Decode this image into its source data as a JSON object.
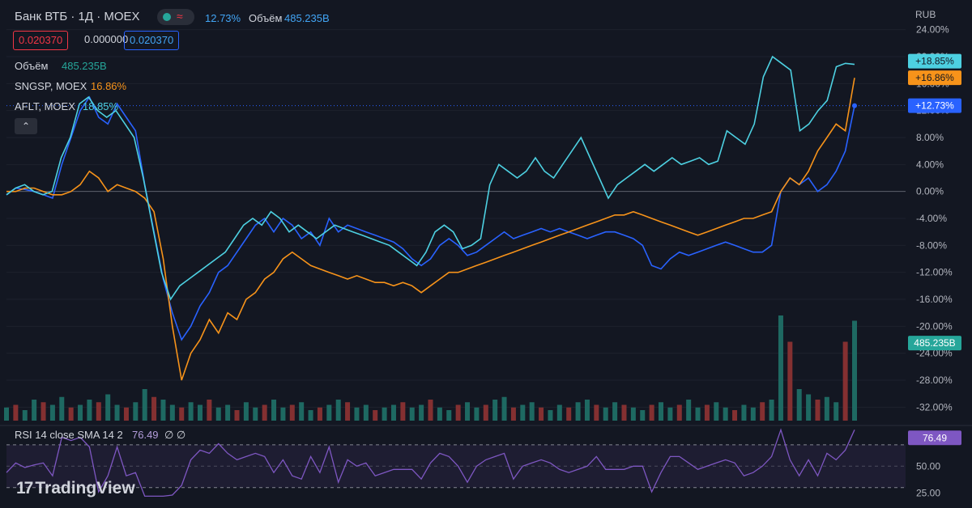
{
  "header": {
    "title": "Банк ВТБ · 1Д · MOEX",
    "change_pct": "12.73%",
    "volume_label": "Объём",
    "volume_value": "485.235B",
    "ohlc": [
      "0.020370",
      "0.000000",
      "0.020370"
    ]
  },
  "legend": [
    {
      "label": "Объём",
      "value": "485.235B",
      "color": "#26a69a"
    },
    {
      "label": "SNGSP, MOEX",
      "value": "16.86%",
      "color": "#f7931a"
    },
    {
      "label": "AFLT, MOEX",
      "value": "18.85%",
      "color": "#4dd0e1"
    }
  ],
  "collapse_icon": "chevron-up-icon",
  "currency": "RUB",
  "rsi": {
    "label": "RSI 14 close SMA 14 2",
    "value": "76.49",
    "extra": "∅ ∅",
    "levels": [
      70,
      50,
      30
    ],
    "ticks": [
      "50.00",
      "25.00"
    ]
  },
  "branding": "TradingView",
  "colors": {
    "vtb": "#2962ff",
    "sngsp": "#f7931a",
    "aflt": "#4dd0e1",
    "vol_up": "#26a69a",
    "vol_down": "#ef5350",
    "rsi": "#7e57c2"
  },
  "chart_data": {
    "type": "line",
    "title": "Банк ВТБ · 1Д · MOEX",
    "ylabel": "",
    "y_unit": "%",
    "ylim": [
      -34,
      26
    ],
    "yticks": [
      "24.00%",
      "20.00%",
      "16.00%",
      "12.00%",
      "8.00%",
      "4.00%",
      "0.00%",
      "-4.00%",
      "-8.00%",
      "-12.00%",
      "-16.00%",
      "-20.00%",
      "-24.00%",
      "-28.00%",
      "-32.00%"
    ],
    "ytick_values": [
      24,
      20,
      16,
      12,
      8,
      4,
      0,
      -4,
      -8,
      -12,
      -16,
      -20,
      -24,
      -28,
      -32
    ],
    "x": [
      0,
      2,
      4,
      6,
      8,
      10,
      12,
      14,
      16,
      18,
      20,
      22,
      24,
      26,
      28,
      30,
      32,
      34,
      36,
      38,
      40,
      42,
      44,
      46,
      48,
      50,
      52,
      54,
      56,
      58,
      60,
      62,
      64,
      66,
      68,
      70,
      72,
      74,
      76,
      78,
      80,
      82,
      84,
      86,
      88,
      90,
      92,
      94,
      96,
      98,
      100,
      102,
      104,
      106,
      108,
      110,
      112,
      114,
      116,
      118,
      120,
      122,
      124,
      126,
      128,
      130,
      132,
      134,
      136,
      138,
      140,
      142,
      144,
      146,
      148,
      150,
      152,
      154,
      156,
      158,
      160,
      162,
      164,
      166,
      168,
      170,
      172,
      174,
      176,
      178,
      180,
      182,
      184,
      186,
      188,
      190,
      192,
      194,
      196,
      198,
      200,
      202,
      204,
      206,
      208,
      210,
      212,
      214,
      216,
      218,
      220,
      222,
      224,
      226,
      228,
      230,
      232,
      234,
      236,
      238
    ],
    "series": [
      {
        "name": "Банк ВТБ",
        "color": "#2962ff",
        "values": [
          -0.5,
          0.5,
          0.3,
          0,
          -0.5,
          -1,
          4,
          8,
          12,
          14,
          11,
          10,
          13,
          11,
          9,
          1,
          -6,
          -13,
          -18,
          -22,
          -20,
          -17,
          -15,
          -12,
          -11,
          -9,
          -7,
          -5,
          -4,
          -6,
          -4,
          -5,
          -7,
          -6,
          -8,
          -4,
          -6,
          -5,
          -5.5,
          -6,
          -6.5,
          -7,
          -7.5,
          -8.5,
          -10,
          -11,
          -10,
          -8,
          -7,
          -8,
          -9.5,
          -9,
          -8,
          -7,
          -6,
          -7,
          -6.5,
          -6,
          -5.5,
          -6,
          -5.5,
          -6,
          -6.5,
          -7,
          -6.5,
          -6,
          -6,
          -6.5,
          -7,
          -8,
          -11,
          -11.5,
          -10,
          -9,
          -9.5,
          -9,
          -8.5,
          -8,
          -7.5,
          -8,
          -8.5,
          -9,
          -9,
          -8,
          0,
          2,
          1,
          2,
          0,
          1,
          3,
          6,
          12.73
        ]
      },
      {
        "name": "SNGSP, MOEX",
        "color": "#f7931a",
        "values": [
          0,
          0,
          0.5,
          0.5,
          0,
          -0.5,
          -0.5,
          0,
          1,
          3,
          2,
          0,
          1,
          0.5,
          0,
          -1,
          -3,
          -10,
          -20,
          -28,
          -24,
          -22,
          -19,
          -21,
          -18,
          -19,
          -16,
          -15,
          -13,
          -12,
          -10,
          -9,
          -10,
          -11,
          -11.5,
          -12,
          -12.5,
          -13,
          -12.5,
          -13,
          -13.5,
          -13.5,
          -14,
          -13.5,
          -14,
          -15,
          -14,
          -13,
          -12,
          -12,
          -11.5,
          -11,
          -10.5,
          -10,
          -9.5,
          -9,
          -8.5,
          -8,
          -7.5,
          -7,
          -6.5,
          -6,
          -5.5,
          -5,
          -4.5,
          -4,
          -3.5,
          -3.5,
          -3,
          -3.5,
          -4,
          -4.5,
          -5,
          -5.5,
          -6,
          -6.5,
          -6,
          -5.5,
          -5,
          -4.5,
          -4,
          -4,
          -3.5,
          -3,
          0,
          2,
          1,
          3,
          6,
          8,
          10,
          9,
          16.86
        ]
      },
      {
        "name": "AFLT, MOEX",
        "color": "#4dd0e1",
        "values": [
          -0.5,
          0.5,
          1,
          0,
          -0.5,
          0,
          5,
          8,
          13,
          14,
          12,
          11,
          12,
          10,
          8,
          2,
          -5,
          -12,
          -16,
          -14,
          -13,
          -12,
          -11,
          -10,
          -9,
          -7,
          -5,
          -4,
          -5,
          -3,
          -4,
          -6,
          -5,
          -6,
          -7,
          -6,
          -5,
          -5.5,
          -6,
          -6.5,
          -7,
          -7.5,
          -8,
          -9,
          -10,
          -11,
          -9,
          -6,
          -5,
          -6,
          -8.5,
          -8,
          -7,
          1,
          4,
          3,
          2,
          3,
          5,
          3,
          2,
          4,
          6,
          8,
          5,
          2,
          -1,
          1,
          2,
          3,
          4,
          3,
          4,
          5,
          4,
          4.5,
          5,
          4,
          4.5,
          9,
          8,
          7,
          10,
          17,
          20,
          19,
          18,
          9,
          10,
          12,
          13.5,
          18.5,
          19,
          18.85
        ]
      }
    ],
    "end_labels": [
      "+18.85%",
      "+16.86%",
      "+12.73%",
      "485.235B"
    ],
    "volume": {
      "values": [
        5,
        6,
        4,
        8,
        7,
        6,
        9,
        5,
        6,
        8,
        7,
        10,
        6,
        5,
        7,
        12,
        9,
        8,
        6,
        5,
        7,
        6,
        8,
        5,
        6,
        4,
        7,
        5,
        6,
        8,
        5,
        6,
        7,
        4,
        5,
        6,
        8,
        7,
        5,
        6,
        4,
        5,
        6,
        7,
        5,
        6,
        8,
        5,
        4,
        6,
        7,
        5,
        6,
        8,
        9,
        5,
        6,
        7,
        5,
        4,
        6,
        5,
        7,
        8,
        6,
        5,
        7,
        6,
        5,
        4,
        6,
        7,
        5,
        6,
        8,
        5,
        6,
        7,
        5,
        4,
        6,
        5,
        7,
        8,
        40,
        30,
        12,
        10,
        8,
        9,
        7,
        30,
        38
      ]
    }
  }
}
